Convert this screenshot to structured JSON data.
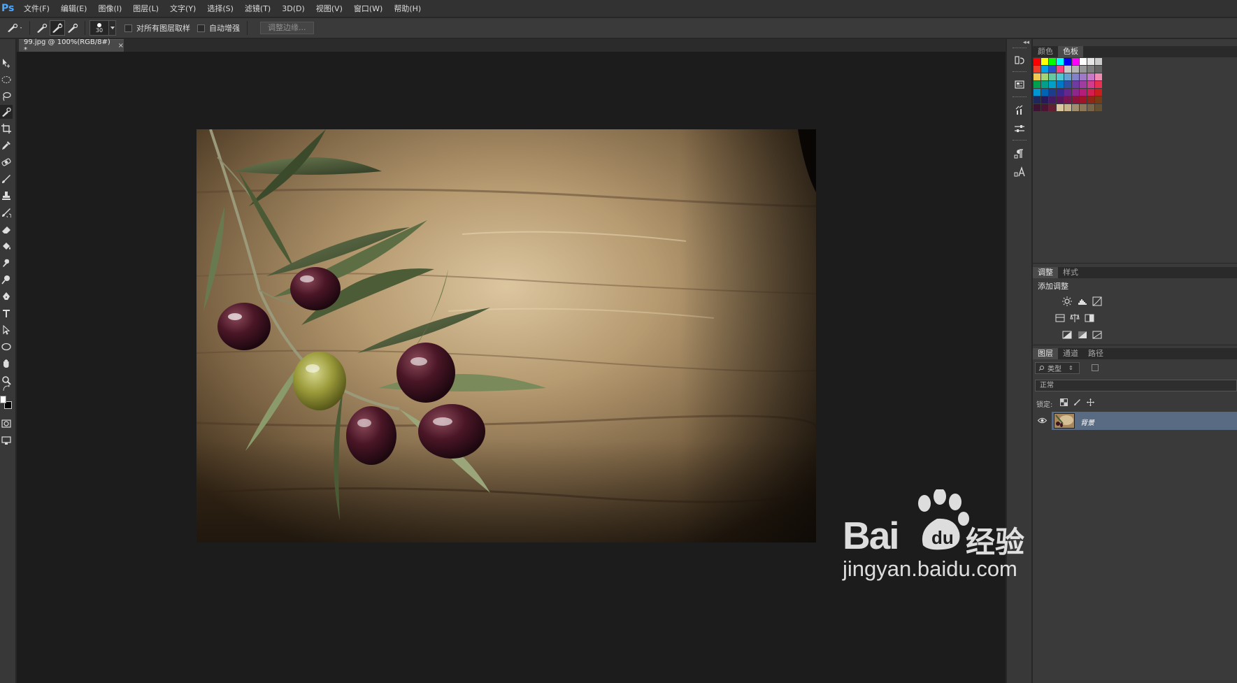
{
  "app": {
    "logo": "Ps",
    "menu": [
      "文件(F)",
      "编辑(E)",
      "图像(I)",
      "图层(L)",
      "文字(Y)",
      "选择(S)",
      "滤镜(T)",
      "3D(D)",
      "视图(V)",
      "窗口(W)",
      "帮助(H)"
    ]
  },
  "options_bar": {
    "brush_size": "30",
    "sample_all_layers_label": "对所有图层取样",
    "auto_enhance_label": "自动增强",
    "refine_edge_label": "调整边缘..."
  },
  "document": {
    "tab_title": "99.jpg @ 100%(RGB/8#) *",
    "close_glyph": "×"
  },
  "panels": {
    "color_tab": "颜色",
    "swatches_tab": "色板",
    "adjustments_tab": "调整",
    "styles_tab": "样式",
    "add_adjustment_label": "添加调整",
    "layers_tab": "图层",
    "channels_tab": "通道",
    "paths_tab": "路径",
    "kind_filter": "类型",
    "blend_mode": "正常",
    "lock_label": "锁定:",
    "layer_name": "背景"
  },
  "swatch_colors": [
    "#ff0000",
    "#ffff00",
    "#00ff00",
    "#00ffff",
    "#0000ff",
    "#ff00ff",
    "#ffffff",
    "#e6e6e6",
    "#cccccc",
    "#f03c28",
    "#00a0e6",
    "#2850c8",
    "#ff4080",
    "#c8c8c8",
    "#b4b4b4",
    "#969696",
    "#7d7d7d",
    "#646464",
    "#f0c850",
    "#a0d278",
    "#64c8a0",
    "#50c8d2",
    "#64a0d2",
    "#8282c8",
    "#a078c8",
    "#c878c8",
    "#f08cb4",
    "#00a050",
    "#00a08c",
    "#00a0c8",
    "#0078c8",
    "#3250a0",
    "#6e3ca0",
    "#a03ca0",
    "#d23c8c",
    "#e63250",
    "#0096d2",
    "#0064b4",
    "#1e3c8c",
    "#3c288c",
    "#64288c",
    "#8c288c",
    "#b41e78",
    "#d21e50",
    "#c81e1e",
    "#1e285a",
    "#28195a",
    "#461964",
    "#5a145a",
    "#781450",
    "#8c143c",
    "#a01428",
    "#8c2814",
    "#783c14",
    "#3c1432",
    "#4b1432",
    "#641e32",
    "#dcc8a0",
    "#c8b48c",
    "#a08c6e",
    "#8c7858",
    "#786446",
    "#645032"
  ],
  "watermark": {
    "baidu": "Bai",
    "brand": "经验",
    "url": "jingyan.baidu.com"
  }
}
